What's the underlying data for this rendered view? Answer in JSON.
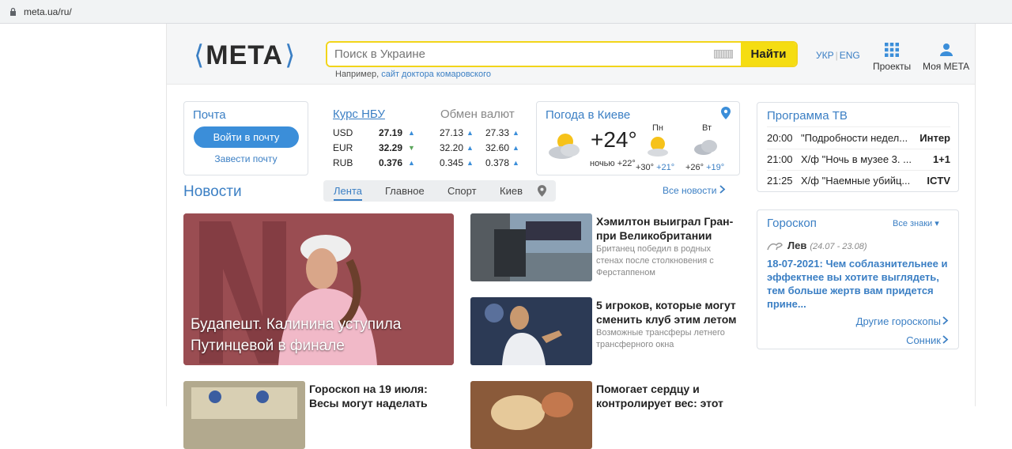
{
  "browser": {
    "url": "meta.ua/ru/"
  },
  "header": {
    "logo_left": "⟨",
    "logo_text": "META",
    "logo_right": "⟩",
    "search_placeholder": "Поиск в Украине",
    "search_button": "Найти",
    "example_prefix": "Например,",
    "example_link": "сайт доктора комаровского",
    "lang_ukr": "УКР",
    "lang_sep": "|",
    "lang_eng": "ENG",
    "projects_label": "Проекты",
    "my_meta_label": "Моя META"
  },
  "mail": {
    "title": "Почта",
    "login_button": "Войти в почту",
    "register_link": "Завести почту"
  },
  "rates": {
    "nbu_title": "Курс НБУ",
    "exchange_title": "Обмен валют",
    "rows": [
      {
        "cur": "USD",
        "nbu": "27.19",
        "nbu_dir": "▲",
        "buy": "27.13",
        "sell": "27.33"
      },
      {
        "cur": "EUR",
        "nbu": "32.29",
        "nbu_dir": "▼",
        "buy": "32.20",
        "sell": "32.60"
      },
      {
        "cur": "RUB",
        "nbu": "0.376",
        "nbu_dir": "▲",
        "buy": "0.345",
        "sell": "0.378"
      }
    ],
    "arrow_up": "▲",
    "colors": {
      "up": "#3b8ed9",
      "down": "#5aa55a"
    }
  },
  "weather": {
    "title": "Погода в Киеве",
    "temp": "+24°",
    "night": "ночью +22°",
    "days": [
      {
        "name": "Пн",
        "hi": "+30°",
        "lo": "+21°"
      },
      {
        "name": "Вт",
        "hi": "+26°",
        "lo": "+19°"
      }
    ]
  },
  "tv": {
    "title": "Программа ТВ",
    "rows": [
      {
        "time": "20:00",
        "prog": "\"Подробности недел...",
        "channel": "Интер"
      },
      {
        "time": "21:00",
        "prog": "Х/ф \"Ночь в музее 3. ...",
        "channel": "1+1"
      },
      {
        "time": "21:25",
        "prog": "Х/ф \"Наемные убийц...",
        "channel": "ICTV"
      }
    ]
  },
  "horoscope": {
    "title": "Гороскоп",
    "all_signs": "Все знаки ▾",
    "sign": "Лев",
    "dates": "(24.07 - 23.08)",
    "text": "18-07-2021: Чем соблазнительнее и эффектнее вы хотите выглядеть, тем больше жертв вам придется прине...",
    "other_link": "Другие гороскопы",
    "dream_link": "Сонник"
  },
  "news": {
    "title": "Новости",
    "tabs": [
      "Лента",
      "Главное",
      "Спорт",
      "Киев"
    ],
    "all_news": "Все новости",
    "main": "Будапешт. Калинина уступила Путинцевой в финале",
    "items": [
      {
        "title": "Хэмилтон выиграл Гран-при Великобритании",
        "sub": "Британец победил в родных стенах после столкновения с Ферстаппеном"
      },
      {
        "title": "5 игроков, которые могут сменить клуб этим летом",
        "sub": "Возможные трансферы летнего трансферного окна"
      },
      {
        "title": "Гороскоп на 19 июля: Весы могут наделать",
        "sub": ""
      },
      {
        "title": "Помогает сердцу и контролирует вес: этот",
        "sub": ""
      }
    ]
  }
}
